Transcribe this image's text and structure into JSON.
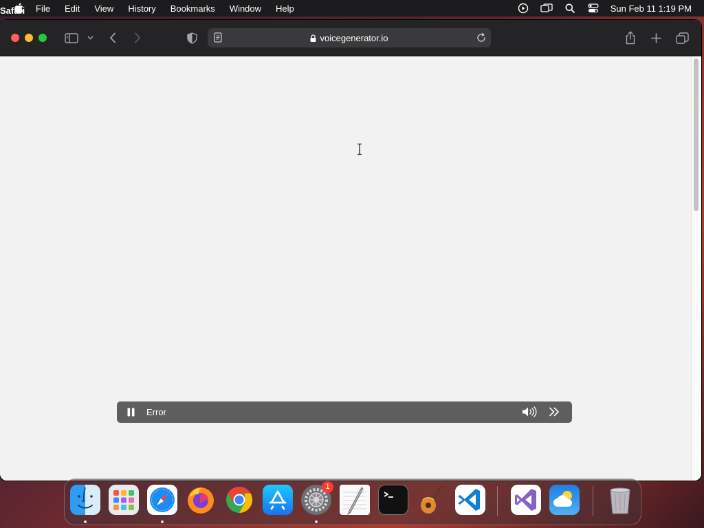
{
  "menubar": {
    "app_name": "Safari",
    "items": [
      "File",
      "Edit",
      "View",
      "History",
      "Bookmarks",
      "Window",
      "Help"
    ],
    "clock": "Sun Feb 11  1:19 PM",
    "status_icons": [
      "screen-record-icon",
      "screen-mirror-icon",
      "spotlight-search-icon",
      "control-center-icon"
    ]
  },
  "browser": {
    "url": "voicegenerator.io",
    "toolbar_icons": [
      "sidebar-icon",
      "chevron-down-icon",
      "back-icon",
      "forward-icon",
      "privacy-shield-icon",
      "reader-icon",
      "lock-icon",
      "reload-icon",
      "share-icon",
      "new-tab-icon",
      "tab-overview-icon"
    ]
  },
  "player": {
    "status": "Error",
    "icons": [
      "pause-icon",
      "volume-icon",
      "skip-forward-icon"
    ]
  },
  "dock": {
    "apps": [
      "Finder",
      "Launchpad",
      "Safari",
      "Firefox",
      "Google Chrome",
      "App Store",
      "System Settings",
      "TextEdit",
      "Terminal",
      "GarageBand",
      "Visual Studio Code",
      "Visual Studio",
      "Weather",
      "Trash"
    ],
    "settings_badge": "1"
  },
  "colors": {
    "menubar_bg": "#1c1c1e",
    "toolbar_bg": "#242426",
    "page_bg": "#f2f2f2",
    "player_bg": "#5e5e5e"
  }
}
